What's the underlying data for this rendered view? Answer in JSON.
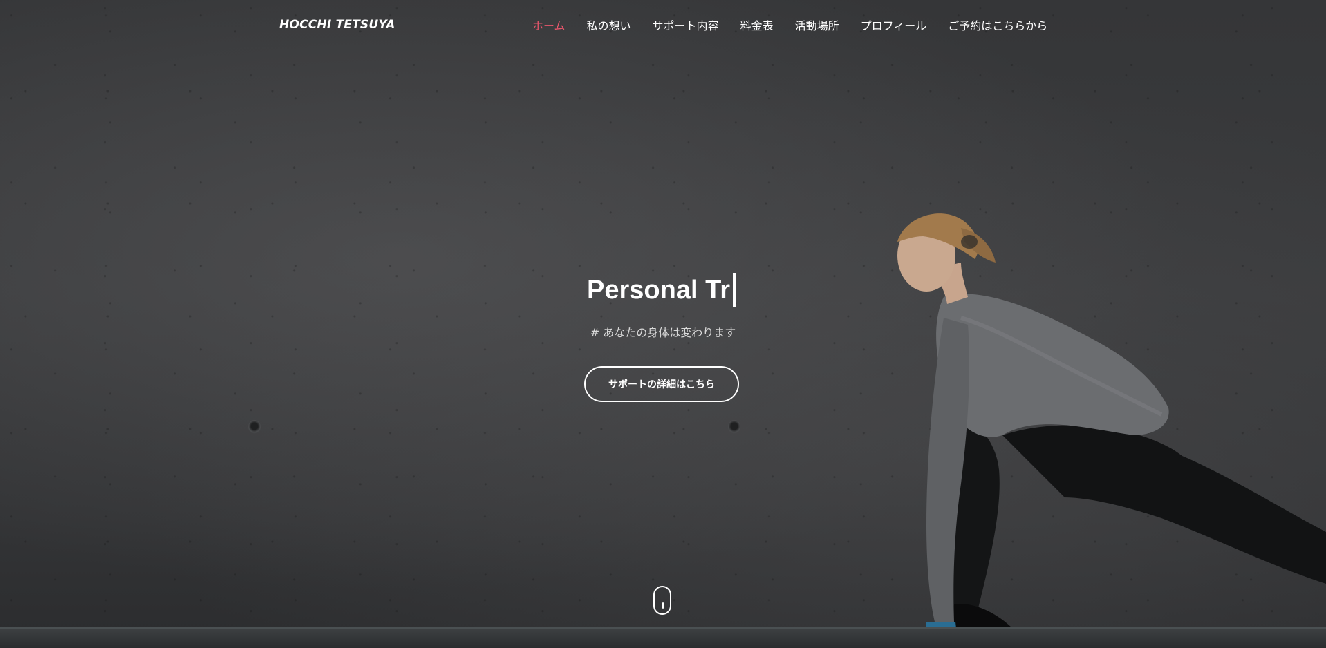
{
  "brand": {
    "logo_text": "HOCCHI TETSUYA"
  },
  "nav": {
    "items": [
      {
        "label": "ホーム",
        "active": true
      },
      {
        "label": "私の想い",
        "active": false
      },
      {
        "label": "サポート内容",
        "active": false
      },
      {
        "label": "料金表",
        "active": false
      },
      {
        "label": "活動場所",
        "active": false
      },
      {
        "label": "プロフィール",
        "active": false
      },
      {
        "label": "ご予約はこちらから",
        "active": false
      }
    ],
    "active_color": "#e8566c",
    "text_color": "#ffffff"
  },
  "hero": {
    "headline": "Personal Tr",
    "tagline": "# あなたの身体は変わります",
    "cta_label": "サポートの詳細はこちら"
  },
  "icons": {
    "scroll_indicator": "mouse-scroll-icon"
  }
}
